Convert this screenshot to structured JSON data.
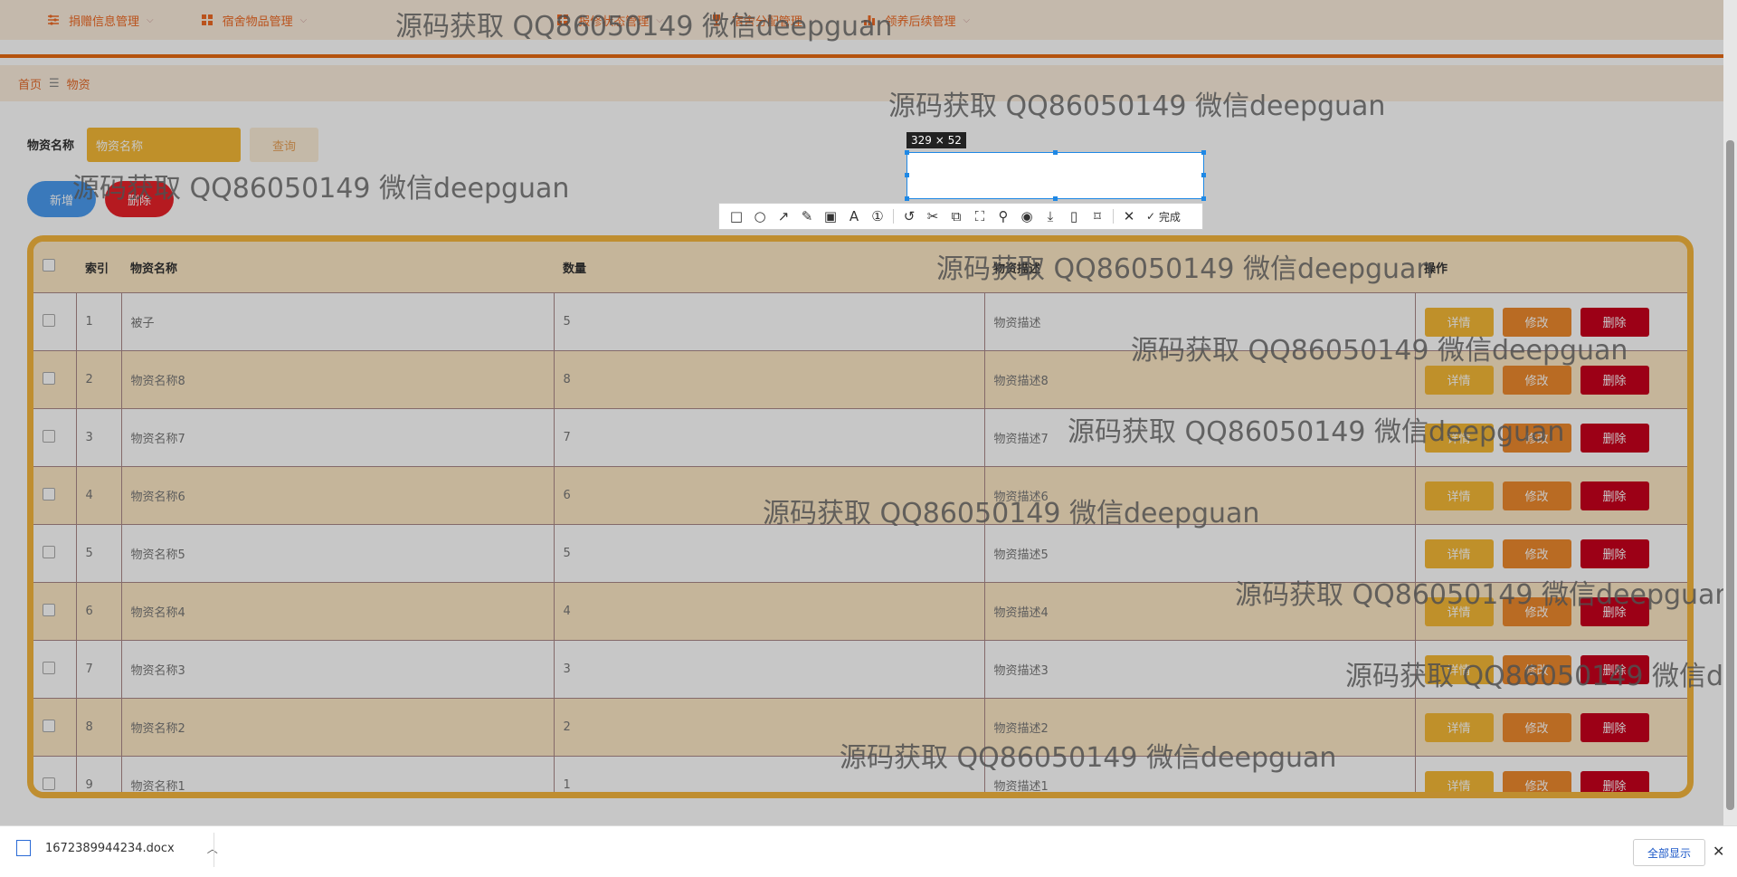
{
  "nav": {
    "items": [
      {
        "label": "捐赠信息管理",
        "icon": "sliders-icon"
      },
      {
        "label": "宿舍物品管理",
        "icon": "grid-icon"
      },
      {
        "label": "",
        "icon": "grid-icon"
      },
      {
        "label": "",
        "icon": "grid-icon"
      },
      {
        "label": "报修状态管理",
        "icon": "grid-icon"
      },
      {
        "label": "宿舍分配管理",
        "icon": "trophy-icon"
      },
      {
        "label": "领养后续管理",
        "icon": "chart-icon"
      }
    ]
  },
  "breadcrumb": {
    "home": "首页",
    "separator": "☰",
    "current": "物资"
  },
  "search": {
    "label": "物资名称",
    "placeholder": "物资名称",
    "button": "查询"
  },
  "actions": {
    "add": "新增",
    "delete": "删除"
  },
  "table": {
    "headers": [
      "",
      "索引",
      "物资名称",
      "数量",
      "物资描述",
      "操作"
    ],
    "rows": [
      {
        "index": "1",
        "name": "被子",
        "qty": "5",
        "desc": "物资描述"
      },
      {
        "index": "2",
        "name": "物资名称8",
        "qty": "8",
        "desc": "物资描述8"
      },
      {
        "index": "3",
        "name": "物资名称7",
        "qty": "7",
        "desc": "物资描述7"
      },
      {
        "index": "4",
        "name": "物资名称6",
        "qty": "6",
        "desc": "物资描述6"
      },
      {
        "index": "5",
        "name": "物资名称5",
        "qty": "5",
        "desc": "物资描述5"
      },
      {
        "index": "6",
        "name": "物资名称4",
        "qty": "4",
        "desc": "物资描述4"
      },
      {
        "index": "7",
        "name": "物资名称3",
        "qty": "3",
        "desc": "物资描述3"
      },
      {
        "index": "8",
        "name": "物资名称2",
        "qty": "2",
        "desc": "物资描述2"
      },
      {
        "index": "9",
        "name": "物资名称1",
        "qty": "1",
        "desc": "物资描述1"
      }
    ],
    "op_labels": {
      "detail": "详情",
      "edit": "修改",
      "remove": "删除"
    }
  },
  "capture": {
    "size": "329 × 52",
    "done": "完成"
  },
  "watermark": "源码获取 QQ86050149 微信deepguan",
  "download": {
    "file": "1672389944234.docx",
    "show_all": "全部显示"
  },
  "colors": {
    "accent": "#e86b12",
    "header_bg": "#fbeedd",
    "detail": "#f5b937",
    "edit": "#ee8a2e",
    "remove": "#c8001d"
  }
}
